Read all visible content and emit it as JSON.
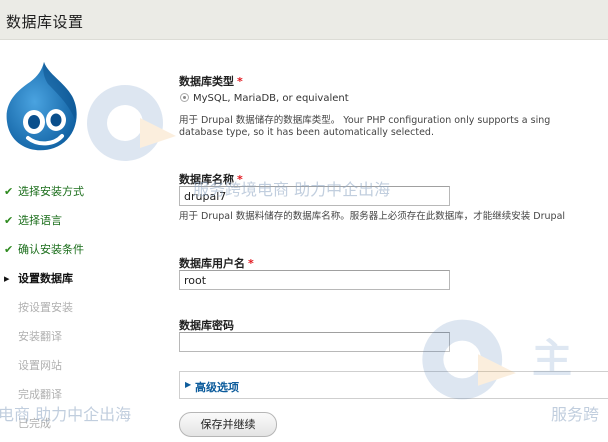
{
  "header": {
    "title": "数据库设置"
  },
  "steps": [
    {
      "label": "选择安装方式",
      "state": "done"
    },
    {
      "label": "选择语言",
      "state": "done"
    },
    {
      "label": "确认安装条件",
      "state": "done"
    },
    {
      "label": "设置数据库",
      "state": "active"
    },
    {
      "label": "按设置安装",
      "state": "todo"
    },
    {
      "label": "安装翻译",
      "state": "todo"
    },
    {
      "label": "设置网站",
      "state": "todo"
    },
    {
      "label": "完成翻译",
      "state": "todo"
    },
    {
      "label": "已完成",
      "state": "todo"
    }
  ],
  "step_marks": {
    "done": "✔",
    "active": "▸"
  },
  "db_type": {
    "label": "数据库类型",
    "required_mark": "*",
    "option": "MySQL, MariaDB, or equivalent",
    "desc_line1": "用于 Drupal 数据储存的数据库类型。 Your PHP configuration only supports a sing",
    "desc_line2": "database type, so it has been automatically selected."
  },
  "db_name": {
    "label": "数据库名称",
    "required_mark": "*",
    "value": "drupal7",
    "desc": "用于 Drupal 数据料储存的数据库名称。服务器上必须存在此数据库，才能继续安装 Drupal"
  },
  "db_user": {
    "label": "数据库用户名",
    "required_mark": "*",
    "value": "root"
  },
  "db_pass": {
    "label": "数据库密码",
    "value": ""
  },
  "advanced": {
    "arrow": "▶",
    "label": "高级选项"
  },
  "submit": {
    "label": "保存并继续"
  },
  "watermarks": {
    "brand_fragment": "主",
    "text_1": "服务跨境电商 助力中企出海",
    "text_2": "电商 助力中企出海",
    "text_3": "服务跨"
  },
  "colors": {
    "accent_link": "#0d5c9c",
    "required": "#e1181f",
    "done": "#2e8a1f"
  }
}
